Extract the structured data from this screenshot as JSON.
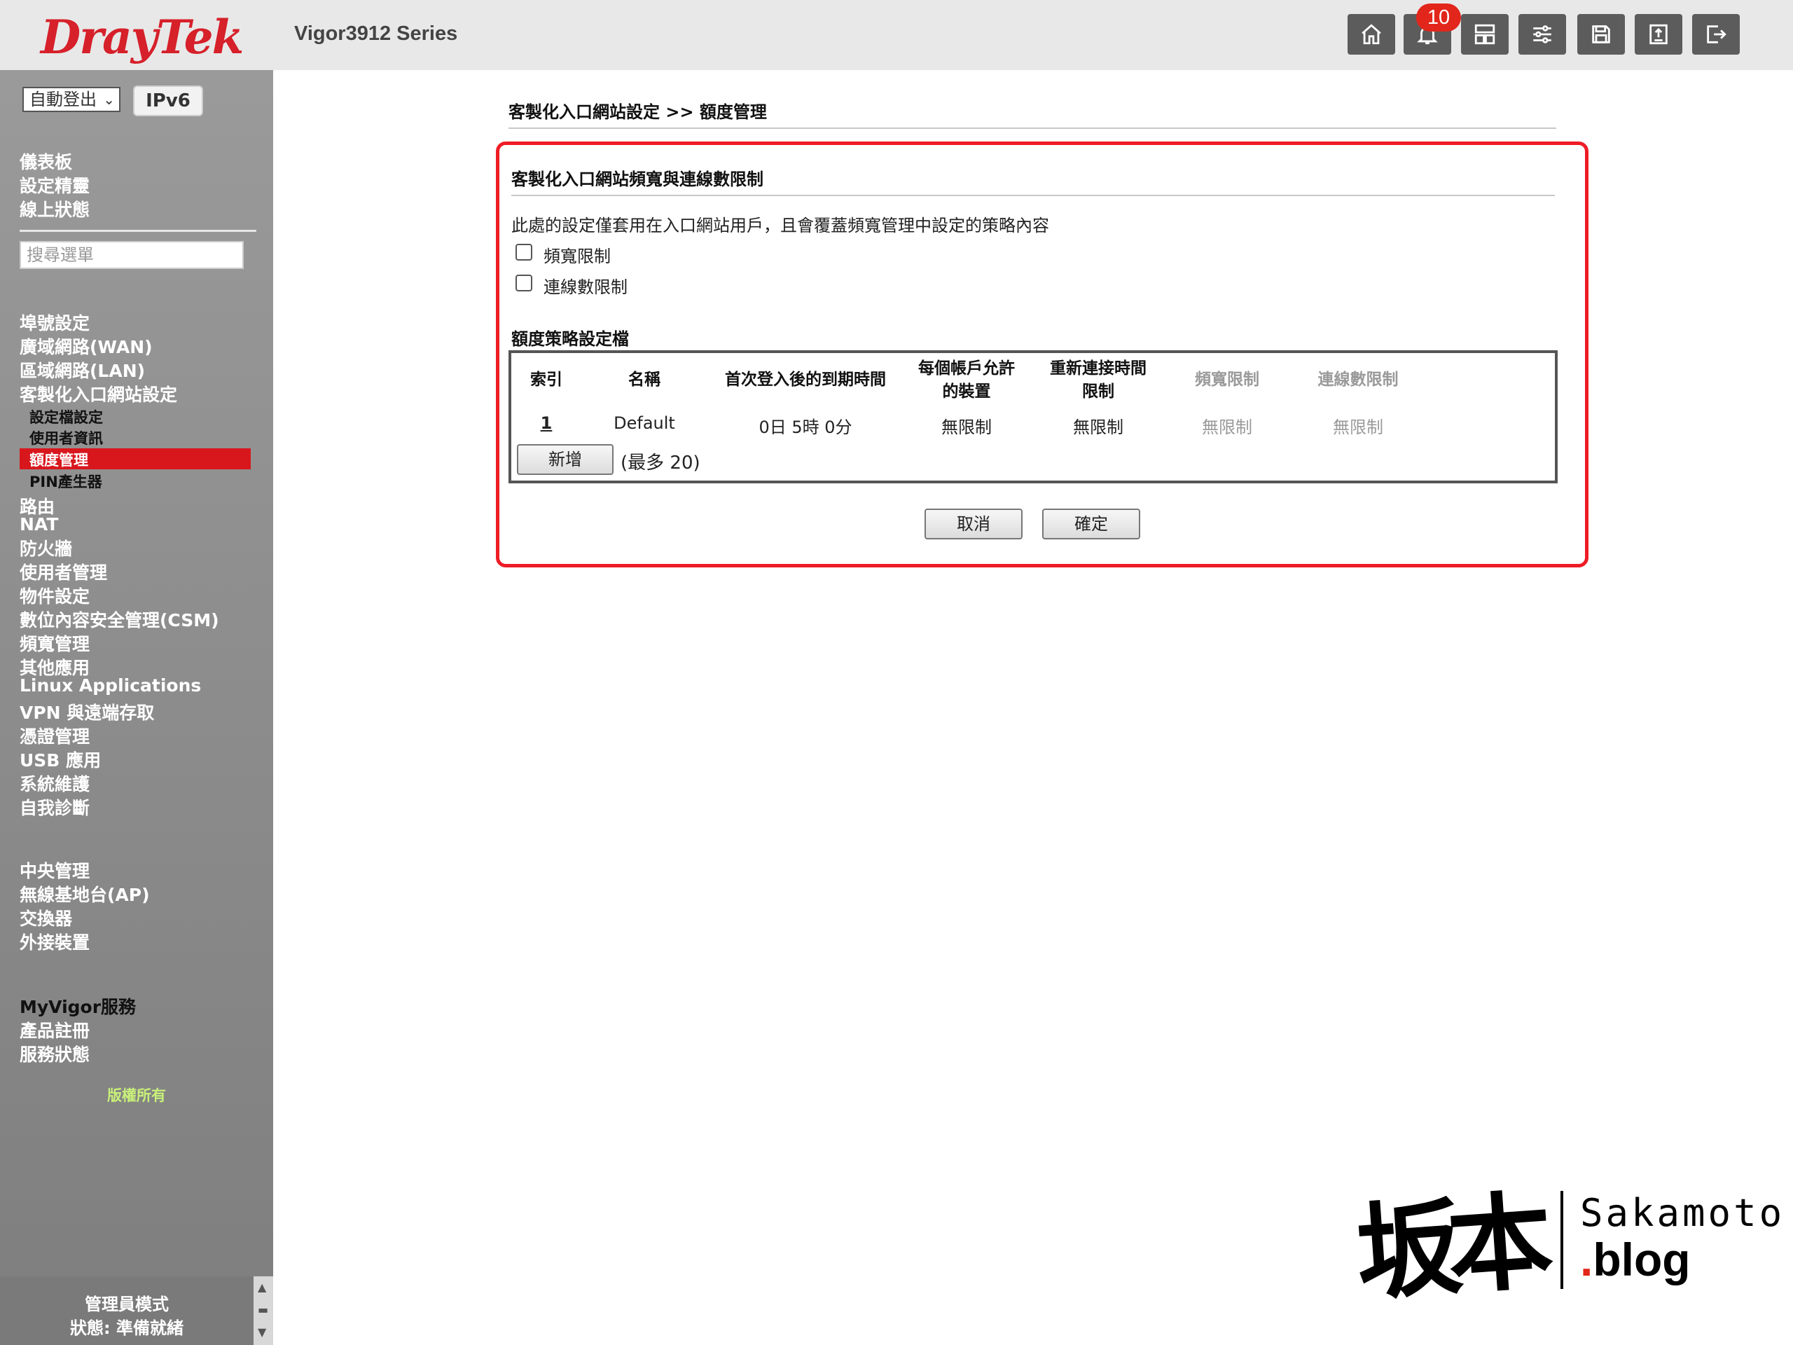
{
  "header": {
    "logo_text": "DrayTek",
    "model": "Vigor3912 Series",
    "notification_count": "10",
    "icons": [
      "home-icon",
      "bell-icon",
      "layout-icon",
      "sliders-icon",
      "save-icon",
      "upload-icon",
      "logout-icon"
    ]
  },
  "sidebar": {
    "logout_option": "自動登出",
    "ipv6_badge": "IPv6",
    "top_links": [
      "儀表板",
      "設定精靈",
      "線上狀態"
    ],
    "search_placeholder": "搜尋選單",
    "menu": [
      "埠號設定",
      "廣域網路(WAN)",
      "區域網路(LAN)",
      "客製化入口網站設定"
    ],
    "submenu": [
      "設定檔設定",
      "使用者資訊",
      "額度管理",
      "PIN產生器"
    ],
    "active_submenu": "額度管理",
    "menu2": [
      "路由",
      "NAT",
      "防火牆",
      "使用者管理",
      "物件設定",
      "數位內容安全管理(CSM)",
      "頻寬管理",
      "其他應用",
      "Linux Applications",
      "VPN 與遠端存取",
      "憑證管理",
      "USB 應用",
      "系統維護",
      "自我診斷"
    ],
    "menu3": [
      "中央管理",
      "無線基地台(AP)",
      "交換器",
      "外接裝置"
    ],
    "menu4": [
      "MyVigor服務",
      "產品註冊",
      "服務狀態"
    ],
    "copyright": "版權所有",
    "admin_mode": "管理員模式",
    "status": "狀態: 準備就緒"
  },
  "main": {
    "breadcrumb": "客製化入口網站設定 >> 額度管理",
    "section_title": "客製化入口網站頻寬與連線數限制",
    "description": "此處的設定僅套用在入口網站用戶，且會覆蓋頻寬管理中設定的策略內容",
    "checkbox_bandwidth": "頻寬限制",
    "checkbox_sessions": "連線數限制",
    "profile_title": "額度策略設定檔",
    "table_headers": {
      "index": "索引",
      "name": "名稱",
      "expiry": "首次登入後的到期時間",
      "devices_1": "每個帳戶允許",
      "devices_2": "的裝置",
      "reconnect_1": "重新連接時間",
      "reconnect_2": "限制",
      "bandwidth": "頻寬限制",
      "sessions": "連線數限制"
    },
    "rows": [
      {
        "index": "1",
        "name": "Default",
        "expiry": "0日 5時 0分",
        "devices": "無限制",
        "reconnect": "無限制",
        "bandwidth": "無限制",
        "sessions": "無限制"
      }
    ],
    "add_button": "新增",
    "max_note": "(最多 20)",
    "cancel_button": "取消",
    "ok_button": "確定"
  },
  "watermark": {
    "kanji": "坂本",
    "name": "Sakamoto",
    "dot": ".",
    "blog": "blog"
  }
}
